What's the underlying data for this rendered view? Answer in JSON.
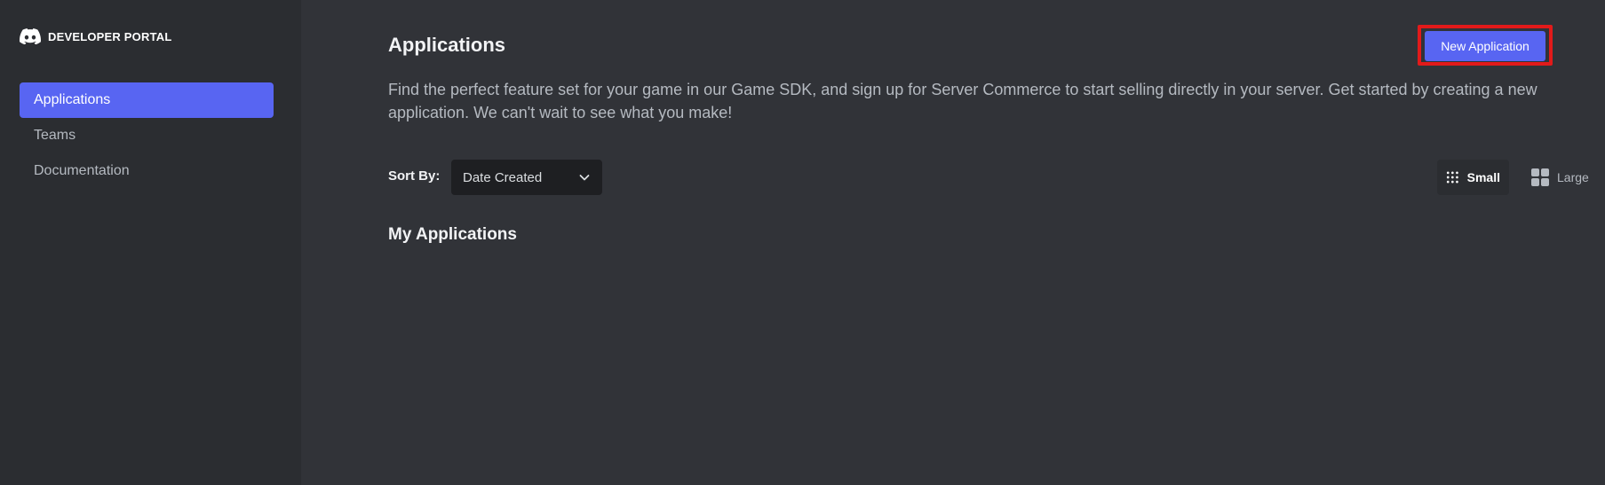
{
  "brand": {
    "title": "DEVELOPER PORTAL",
    "logo_icon": "discord-logo-icon"
  },
  "sidebar": {
    "items": [
      {
        "label": "Applications",
        "active": true
      },
      {
        "label": "Teams",
        "active": false
      },
      {
        "label": "Documentation",
        "active": false
      }
    ]
  },
  "main": {
    "title": "Applications",
    "new_app_button": "New Application",
    "description": "Find the perfect feature set for your game in our Game SDK, and sign up for Server Commerce to start selling directly in your server. Get started by creating a new application. We can't wait to see what you make!",
    "sort": {
      "label": "Sort By:",
      "value": "Date Created"
    },
    "view_options": {
      "small": "Small",
      "large": "Large",
      "selected": "Small"
    },
    "section_title": "My Applications"
  },
  "colors": {
    "accent": "#5865f2",
    "highlight": "#e21a1a",
    "background": "#313338",
    "sidebar": "#2b2d31"
  }
}
